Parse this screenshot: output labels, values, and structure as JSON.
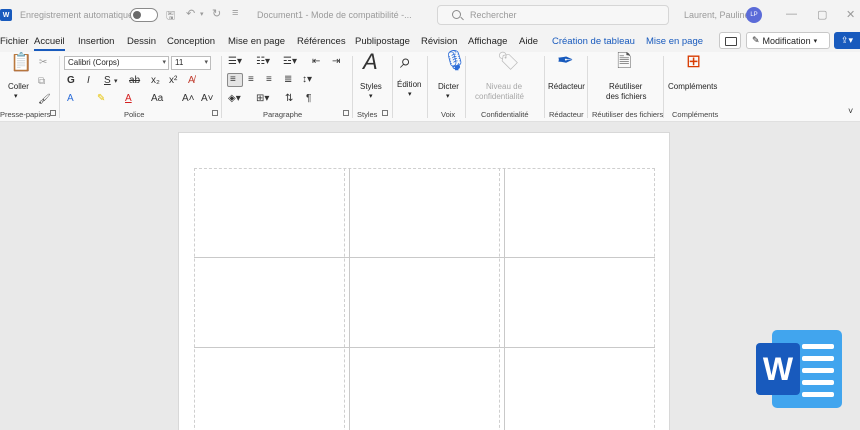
{
  "titlebar": {
    "autosave_label": "Enregistrement automatique",
    "doc_title": "Document1  -  Mode de compatibilité  -...",
    "search_placeholder": "Rechercher",
    "user_name": "Laurent, Pauline",
    "user_initials": "LP"
  },
  "tabs": [
    {
      "label": "Fichier",
      "active": false
    },
    {
      "label": "Accueil",
      "active": true
    },
    {
      "label": "Insertion",
      "active": false
    },
    {
      "label": "Dessin",
      "active": false
    },
    {
      "label": "Conception",
      "active": false
    },
    {
      "label": "Mise en page",
      "active": false
    },
    {
      "label": "Références",
      "active": false
    },
    {
      "label": "Publipostage",
      "active": false
    },
    {
      "label": "Révision",
      "active": false
    },
    {
      "label": "Affichage",
      "active": false
    },
    {
      "label": "Aide",
      "active": false
    },
    {
      "label": "Création de tableau",
      "active": false,
      "contextual": true
    },
    {
      "label": "Mise en page",
      "active": false,
      "contextual": true
    }
  ],
  "header_buttons": {
    "modification": "Modification"
  },
  "ribbon": {
    "clipboard": {
      "paste": "Coller",
      "group": "Presse-papiers"
    },
    "font": {
      "name": "Calibri (Corps)",
      "size": "11",
      "group": "Police",
      "case": "Aa"
    },
    "paragraph": {
      "group": "Paragraphe"
    },
    "styles": {
      "button": "Styles",
      "group": "Styles"
    },
    "editing": {
      "button": "Édition"
    },
    "voice": {
      "button": "Dicter",
      "group": "Voix"
    },
    "sensitivity": {
      "line1": "Niveau de",
      "line2": "confidentialité",
      "group": "Confidentialité"
    },
    "editor": {
      "button": "Rédacteur",
      "group": "Rédacteur"
    },
    "reuse": {
      "line1": "Réutiliser",
      "line2": "des fichiers",
      "group": "Réutiliser des fichiers"
    },
    "addins": {
      "button": "Compléments",
      "group": "Compléments"
    }
  },
  "colors": {
    "accent": "#185abd",
    "word_light": "#41a5ee",
    "ribbon_bg": "#f9f9f9",
    "canvas_bg": "#e9e9e9"
  },
  "table": {
    "rows": 3,
    "cols": 3
  }
}
